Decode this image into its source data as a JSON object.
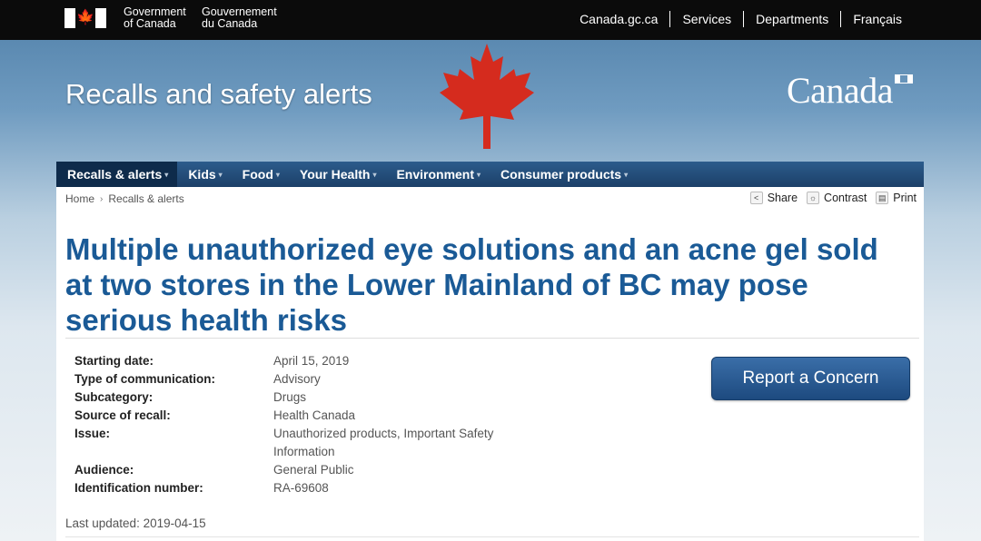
{
  "header": {
    "gov_en": [
      "Government",
      "of Canada"
    ],
    "gov_fr": [
      "Gouvernement",
      "du Canada"
    ],
    "links": [
      "Canada.gc.ca",
      "Services",
      "Departments",
      "Français"
    ]
  },
  "banner": {
    "title": "Recalls and safety alerts",
    "wordmark": "Canada",
    "brand_red": "#d52b1e"
  },
  "nav": {
    "items": [
      "Recalls & alerts",
      "Kids",
      "Food",
      "Your Health",
      "Environment",
      "Consumer products"
    ]
  },
  "breadcrumb": [
    "Home",
    "Recalls & alerts"
  ],
  "tools": [
    "Share",
    "Contrast",
    "Print"
  ],
  "page_title": "Multiple unauthorized eye solutions and an acne gel sold at two stores in the Lower Mainland of BC may pose serious health risks",
  "details": [
    {
      "label": "Starting date:",
      "value": "April 15, 2019"
    },
    {
      "label": "Type of communication:",
      "value": "Advisory"
    },
    {
      "label": "Subcategory:",
      "value": "Drugs"
    },
    {
      "label": "Source of recall:",
      "value": "Health Canada"
    },
    {
      "label": "Issue:",
      "value": "Unauthorized products, Important Safety Information"
    },
    {
      "label": "Audience:",
      "value": "General Public"
    },
    {
      "label": "Identification number:",
      "value": "RA-69608"
    }
  ],
  "report_button": "Report a Concern",
  "last_updated": "Last updated: 2019-04-15"
}
